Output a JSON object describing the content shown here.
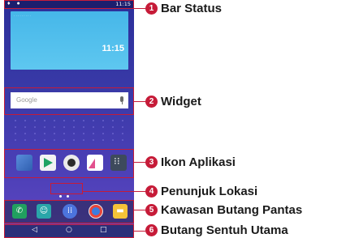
{
  "phone": {
    "statusbar_time": "11:15",
    "widget_time": "11:15",
    "search_placeholder": "Google",
    "nav_back": "◁",
    "nav_home": "○",
    "nav_recent": "□"
  },
  "callouts": [
    {
      "number": "1",
      "label": "Bar Status"
    },
    {
      "number": "2",
      "label": "Widget"
    },
    {
      "number": "3",
      "label": "Ikon Aplikasi"
    },
    {
      "number": "4",
      "label": "Penunjuk Lokasi"
    },
    {
      "number": "5",
      "label": "Kawasan Butang Pantas"
    },
    {
      "number": "6",
      "label": "Butang Sentuh Utama"
    }
  ],
  "colors": {
    "accent": "#c61b38",
    "widget_blue": "#4fbfec",
    "wallpaper": "#3a3aa8"
  },
  "icons": {
    "apps": [
      "settings-app-icon",
      "play-store-icon",
      "camera-icon",
      "gallery-icon",
      "apps-folder-icon"
    ],
    "dock": [
      "phone-icon",
      "contacts-icon",
      "app-drawer-icon",
      "chrome-icon",
      "messages-icon"
    ]
  }
}
